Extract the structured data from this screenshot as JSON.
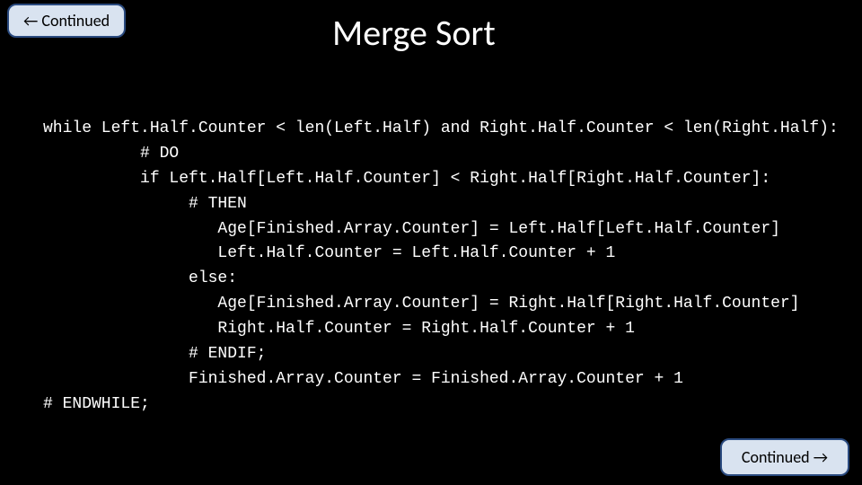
{
  "title": "Merge Sort",
  "nav": {
    "prev_label": "Continued",
    "next_label": "Continued",
    "left_arrow": "←",
    "right_arrow": "→"
  },
  "code": {
    "l1": "while Left.Half.Counter < len(Left.Half) and Right.Half.Counter < len(Right.Half):",
    "l2": "          # DO",
    "l3": "          if Left.Half[Left.Half.Counter] < Right.Half[Right.Half.Counter]:",
    "l4": "               # THEN",
    "l5": "                  Age[Finished.Array.Counter] = Left.Half[Left.Half.Counter]",
    "l6": "                  Left.Half.Counter = Left.Half.Counter + 1",
    "l7": "               else:",
    "l8": "                  Age[Finished.Array.Counter] = Right.Half[Right.Half.Counter]",
    "l9": "                  Right.Half.Counter = Right.Half.Counter + 1",
    "l10": "               # ENDIF;",
    "l11": "               Finished.Array.Counter = Finished.Array.Counter + 1",
    "l12": "# ENDWHILE;"
  }
}
